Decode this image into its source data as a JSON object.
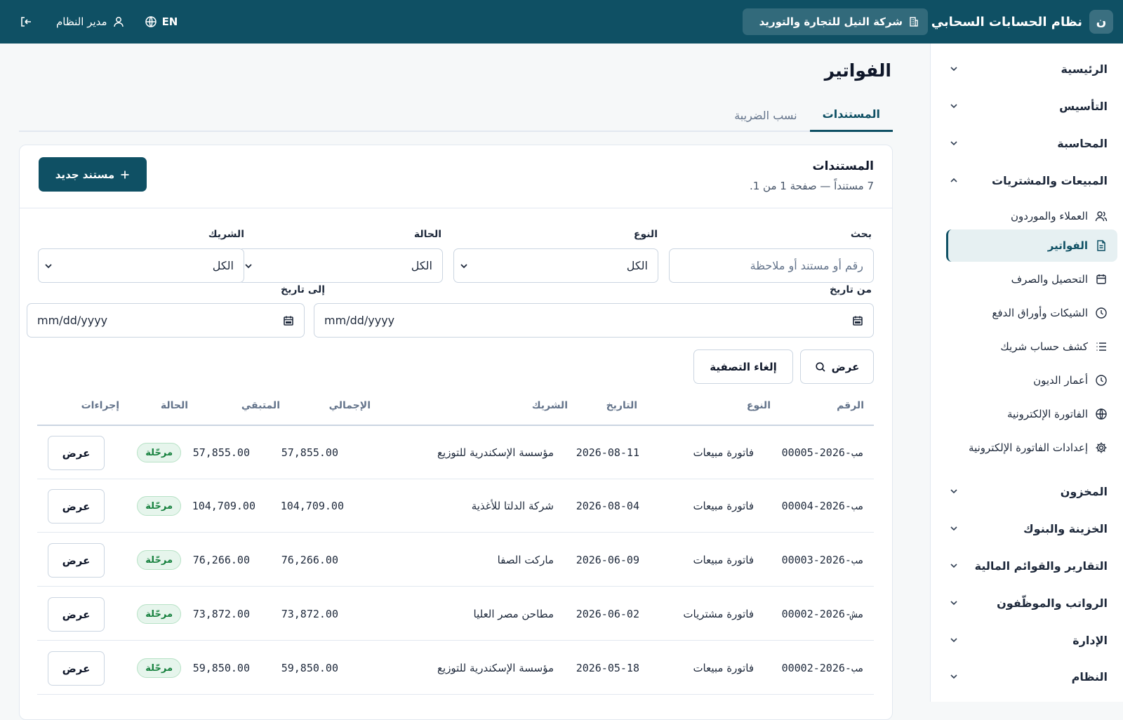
{
  "topbar": {
    "brand_badge": "ن",
    "brand_name": "نظام الحسابات السحابي",
    "company": "شركة النيل للتجارة والتوريد",
    "lang": "EN",
    "user": "مدير النظام"
  },
  "sidebar": {
    "sections": [
      {
        "label": "الرئيسية",
        "expanded": false
      },
      {
        "label": "التأسيس",
        "expanded": false
      },
      {
        "label": "المحاسبة",
        "expanded": false
      },
      {
        "label": "المبيعات والمشتريات",
        "expanded": true
      },
      {
        "label": "المخزون",
        "expanded": false
      },
      {
        "label": "الخزينة والبنوك",
        "expanded": false
      },
      {
        "label": "التقارير والقوائم المالية",
        "expanded": false
      },
      {
        "label": "الرواتب والموظّفون",
        "expanded": false
      },
      {
        "label": "الإدارة",
        "expanded": false
      },
      {
        "label": "النظام",
        "expanded": false
      }
    ],
    "items": [
      {
        "label": "العملاء والموردون",
        "icon": "users-icon"
      },
      {
        "label": "الفواتير",
        "icon": "document-icon",
        "active": true
      },
      {
        "label": "التحصيل والصرف",
        "icon": "calendar-icon"
      },
      {
        "label": "الشيكات وأوراق الدفع",
        "icon": "clock-icon"
      },
      {
        "label": "كشف حساب شريك",
        "icon": "list-icon"
      },
      {
        "label": "أعمار الديون",
        "icon": "clock-icon"
      },
      {
        "label": "الفاتورة الإلكترونية",
        "icon": "globe-icon"
      },
      {
        "label": "إعدادات الفاتورة الإلكترونية",
        "icon": "gear-icon"
      }
    ]
  },
  "page": {
    "title": "الفواتير",
    "tabs": [
      {
        "label": "المستندات",
        "active": true
      },
      {
        "label": "نسب الضريبة",
        "active": false
      }
    ]
  },
  "card": {
    "title": "المستندات",
    "subtitle": "7 مستنداً — صفحة 1 من 1.",
    "new_button": "مستند جديد"
  },
  "filters": {
    "search_label": "بحث",
    "search_placeholder": "رقم أو مستند أو ملاحظة",
    "type_label": "النوع",
    "type_value": "الكل",
    "status_label": "الحالة",
    "status_value": "الكل",
    "partner_label": "الشريك",
    "partner_value": "الكل",
    "from_label": "من تاريخ",
    "from_value": "mm/dd/yyyy",
    "to_label": "إلى تاريخ",
    "to_value": "mm/dd/yyyy",
    "show_button": "عرض",
    "clear_button": "إلغاء التصفية"
  },
  "table": {
    "headers": {
      "number": "الرقم",
      "type": "النوع",
      "date": "التاريخ",
      "partner": "الشريك",
      "total": "الإجمالي",
      "remaining": "المتبقي",
      "status": "الحالة",
      "actions": "إجراءات"
    },
    "rows": [
      {
        "number": "مب-2026-00005",
        "type": "فاتورة مبيعات",
        "date": "2026-08-11",
        "partner": "مؤسسة الإسكندرية للتوزيع",
        "total": "57,855.00",
        "remaining": "57,855.00",
        "status": "مرحّلة",
        "action": "عرض"
      },
      {
        "number": "مب-2026-00004",
        "type": "فاتورة مبيعات",
        "date": "2026-08-04",
        "partner": "شركة الدلتا للأغذية",
        "total": "104,709.00",
        "remaining": "104,709.00",
        "status": "مرحّلة",
        "action": "عرض"
      },
      {
        "number": "مب-2026-00003",
        "type": "فاتورة مبيعات",
        "date": "2026-06-09",
        "partner": "ماركت الصفا",
        "total": "76,266.00",
        "remaining": "76,266.00",
        "status": "مرحّلة",
        "action": "عرض"
      },
      {
        "number": "مش-2026-00002",
        "type": "فاتورة مشتريات",
        "date": "2026-06-02",
        "partner": "مطاحن مصر العليا",
        "total": "73,872.00",
        "remaining": "73,872.00",
        "status": "مرحّلة",
        "action": "عرض"
      },
      {
        "number": "مب-2026-00002",
        "type": "فاتورة مبيعات",
        "date": "2026-05-18",
        "partner": "مؤسسة الإسكندرية للتوزيع",
        "total": "59,850.00",
        "remaining": "59,850.00",
        "status": "مرحّلة",
        "action": "عرض"
      }
    ]
  }
}
